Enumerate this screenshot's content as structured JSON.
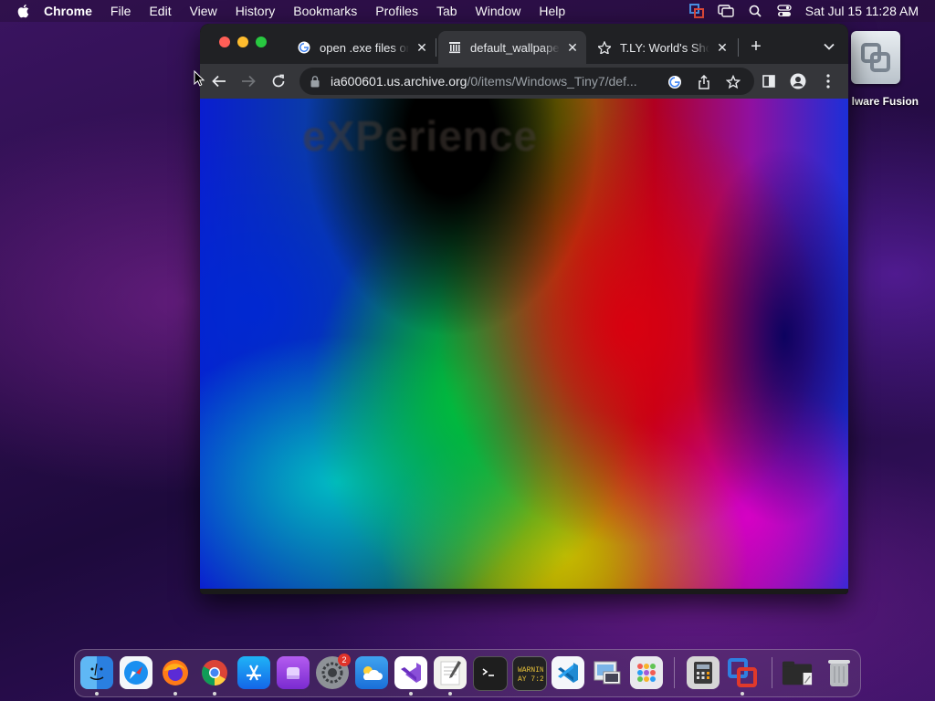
{
  "menubar": {
    "app_name": "Chrome",
    "items": [
      "File",
      "Edit",
      "View",
      "History",
      "Bookmarks",
      "Profiles",
      "Tab",
      "Window",
      "Help"
    ],
    "clock": "Sat Jul 15  11:28 AM",
    "status_icons": [
      "vmware-fusion-icon",
      "screen-mirroring-icon",
      "search-icon",
      "control-center-icon"
    ]
  },
  "desktop": {
    "icon_label": "lware Fusion",
    "icon_name": "vmware-fusion-icon"
  },
  "browser": {
    "tabs": [
      {
        "title": "open .exe files on",
        "icon": "google-icon",
        "active": false
      },
      {
        "title": "default_wallpaper",
        "icon": "archive-icon",
        "active": true
      },
      {
        "title": "T.LY: World's Sho",
        "icon": "tly-icon",
        "active": false
      }
    ],
    "new_tab_label": "+",
    "omnibox": {
      "url_host": "ia600601.us.archive.org",
      "url_rest": "/0/items/Windows_Tiny7/def..."
    },
    "page": {
      "watermark": "eXPerience"
    }
  },
  "dock": {
    "apps": [
      {
        "name": "finder-icon",
        "running": true
      },
      {
        "name": "safari-icon",
        "running": false
      },
      {
        "name": "firefox-icon",
        "running": true
      },
      {
        "name": "chrome-icon",
        "running": true
      },
      {
        "name": "app-store-icon",
        "running": false
      },
      {
        "name": "podcasts-icon",
        "running": false
      },
      {
        "name": "system-settings-icon",
        "running": false,
        "badge": "2"
      },
      {
        "name": "weather-icon",
        "running": false
      },
      {
        "name": "visual-studio-icon",
        "running": true
      },
      {
        "name": "textedit-icon",
        "running": true
      },
      {
        "name": "terminal-icon",
        "running": false
      },
      {
        "name": "console-icon",
        "running": false,
        "text": "WARNIN\nAY 7:26"
      },
      {
        "name": "vscode-icon",
        "running": false
      },
      {
        "name": "preview-icon",
        "running": false
      },
      {
        "name": "launchpad-icon",
        "running": false
      },
      {
        "name": "calculator-icon",
        "running": false
      },
      {
        "name": "vmware-fusion-icon",
        "running": true
      },
      {
        "name": "downloads-folder-icon",
        "running": false
      },
      {
        "name": "trash-icon",
        "running": false
      }
    ]
  },
  "colors": {
    "chrome_frame": "#202124",
    "chrome_toolbar": "#35363a",
    "traffic_close": "#ff5f57",
    "traffic_min": "#febc2e",
    "traffic_max": "#28c840"
  }
}
